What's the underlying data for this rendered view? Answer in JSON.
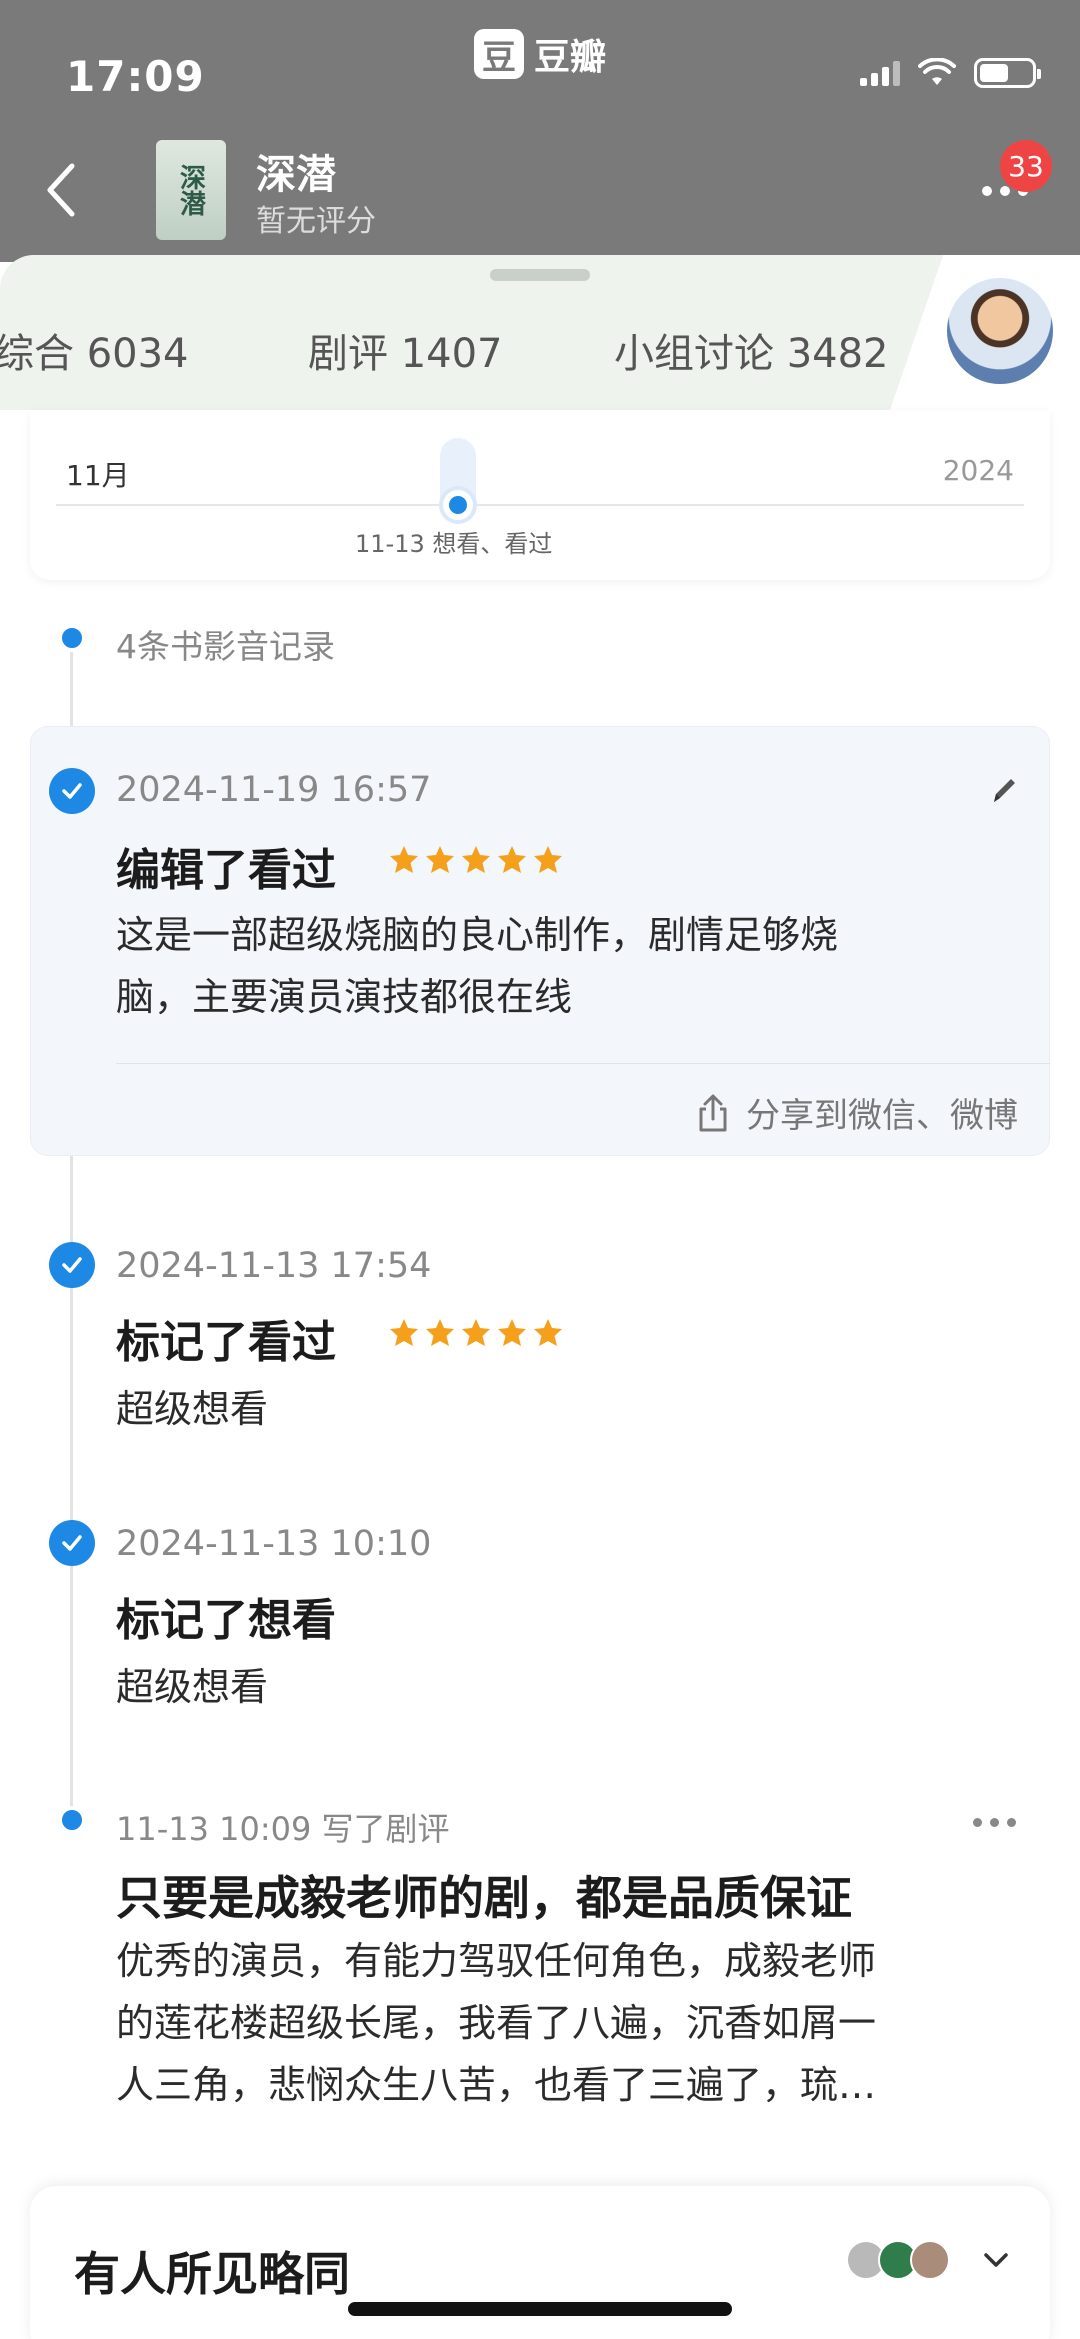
{
  "status_bar": {
    "time": "17:09"
  },
  "app": {
    "logo_char": "豆",
    "name": "豆瓣"
  },
  "movie": {
    "title": "深潜",
    "rating_text": "暂无评分",
    "cover_text": "深潜"
  },
  "notifications": {
    "count": "33"
  },
  "tabs": [
    {
      "label": "综合 6034"
    },
    {
      "label": "剧评 1407"
    },
    {
      "label": "小组讨论 3482"
    }
  ],
  "timeline": {
    "month": "11月",
    "year": "2024",
    "marker_label": "11-13 想看、看过"
  },
  "records": {
    "count_label": "4条书影音记录"
  },
  "entries": [
    {
      "date": "2024-11-19 16:57",
      "action": "编辑了看过",
      "stars": 5,
      "comment_line1": "这是一部超级烧脑的良心制作，剧情足够烧",
      "comment_line2": "脑，主要演员演技都很在线",
      "share_label": "分享到微信、微博"
    },
    {
      "date": "2024-11-13 17:54",
      "action": "标记了看过",
      "stars": 5,
      "comment": "超级想看"
    },
    {
      "date": "2024-11-13 10:10",
      "action": "标记了想看",
      "comment": "超级想看"
    }
  ],
  "review": {
    "meta": "11-13 10:09 写了剧评",
    "title": "只要是成毅老师的剧，都是品质保证",
    "line1": "优秀的演员，有能力驾驭任何角色，成毅老师",
    "line2": "的莲花楼超级长尾，我看了八遍，沉香如屑一",
    "line3": "人三角，悲悯众生八苦，也看了三遍了，琉…"
  },
  "bottom": {
    "title": "有人所见略同"
  },
  "colors": {
    "accent": "#1e88e5",
    "star": "#f5a01a",
    "badge": "#ef4444"
  }
}
